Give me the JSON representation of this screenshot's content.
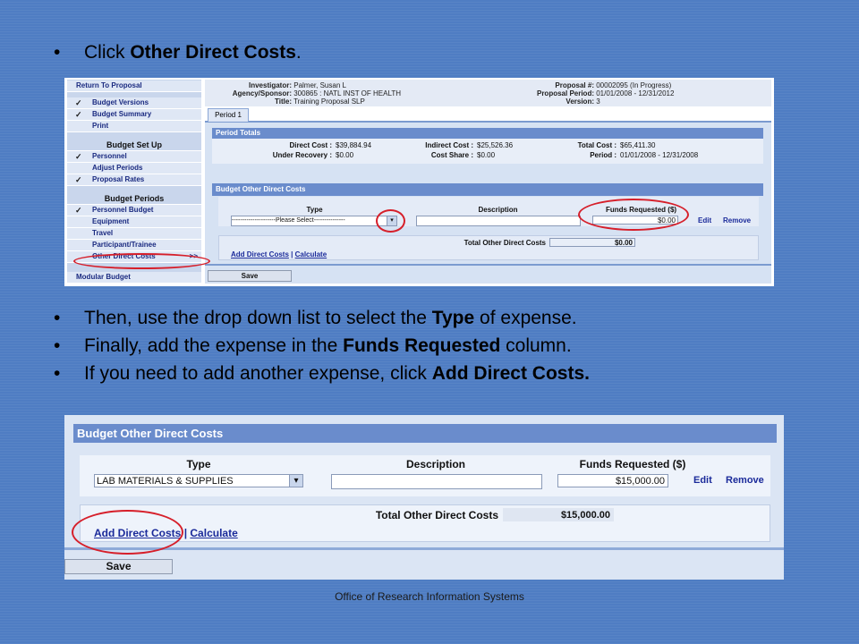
{
  "slide": {
    "bullet1": {
      "pre": "Click ",
      "bold": "Other Direct Costs",
      "post": "."
    },
    "bullet2": {
      "pre": "Then, use the drop down list to select the ",
      "bold": "Type",
      "post": " of expense."
    },
    "bullet3": {
      "pre": "Finally, add the expense in the ",
      "bold": "Funds Requested",
      "post": " column."
    },
    "bullet4": {
      "pre": "If you need to add another expense, click ",
      "bold": "Add Direct Costs.",
      "post": ""
    },
    "footer": "Office of Research Information Systems",
    "bullet_char": "•"
  },
  "shot1": {
    "sidebar": {
      "return": "Return To Proposal",
      "items_a": [
        {
          "label": "Budget Versions",
          "check": "✓"
        },
        {
          "label": "Budget Summary",
          "check": "✓"
        },
        {
          "label": "Print",
          "check": ""
        }
      ],
      "setup_head": "Budget Set Up",
      "items_b": [
        {
          "label": "Personnel",
          "check": "✓"
        },
        {
          "label": "Adjust Periods",
          "check": ""
        },
        {
          "label": "Proposal Rates",
          "check": "✓"
        }
      ],
      "periods_head": "Budget Periods",
      "items_c": [
        {
          "label": "Personnel Budget",
          "check": "✓"
        },
        {
          "label": "Equipment",
          "check": ""
        },
        {
          "label": "Travel",
          "check": ""
        },
        {
          "label": "Participant/Trainee",
          "check": ""
        },
        {
          "label": "Other Direct Costs",
          "check": "",
          "suffix": ">>"
        }
      ],
      "modular": "Modular Budget"
    },
    "header": {
      "investigator_label": "Investigator:",
      "investigator": "Palmer, Susan L",
      "agency_label": "Agency/Sponsor:",
      "agency": "300865 : NATL INST OF HEALTH",
      "title_label": "Title:",
      "title": "Training Proposal SLP",
      "proposal_label": "Proposal #:",
      "proposal": "00002095 (In Progress)",
      "period_label": "Proposal Period:",
      "period": "01/01/2008 - 12/31/2012",
      "version_label": "Version:",
      "version": "3"
    },
    "tab": "Period 1",
    "period_totals": {
      "title": "Period Totals",
      "direct_label": "Direct Cost :",
      "direct": "$39,884.94",
      "indirect_label": "Indirect Cost :",
      "indirect": "$25,526.36",
      "total_label": "Total Cost :",
      "total": "$65,411.30",
      "under_label": "Under Recovery :",
      "under": "$0.00",
      "share_label": "Cost Share :",
      "share": "$0.00",
      "period_label": "Period :",
      "period": "01/01/2008 - 12/31/2008"
    },
    "odc": {
      "title": "Budget Other Direct Costs",
      "col_type": "Type",
      "col_desc": "Description",
      "col_funds": "Funds Requested ($)",
      "type_value": "---------------------Please Select---------------",
      "desc_value": "",
      "funds_value": "$0.00",
      "edit": "Edit",
      "remove": "Remove",
      "total_label": "Total Other Direct Costs",
      "total": "$0.00",
      "add": "Add Direct Costs",
      "sep": " | ",
      "calc": "Calculate"
    },
    "save": "Save"
  },
  "shot2": {
    "odc": {
      "title": "Budget Other Direct Costs",
      "col_type": "Type",
      "col_desc": "Description",
      "col_funds": "Funds Requested ($)",
      "type_value": "LAB MATERIALS & SUPPLIES",
      "desc_value": "",
      "funds_value": "$15,000.00",
      "edit": "Edit",
      "remove": "Remove",
      "total_label": "Total Other Direct Costs",
      "total": "$15,000.00",
      "add": "Add Direct Costs",
      "sep": " | ",
      "calc": "Calculate"
    },
    "save": "Save"
  },
  "colors": {
    "background": "#4f7dc3",
    "highlight_circle": "#d61f2a",
    "panel_header": "#6a8ccc"
  }
}
